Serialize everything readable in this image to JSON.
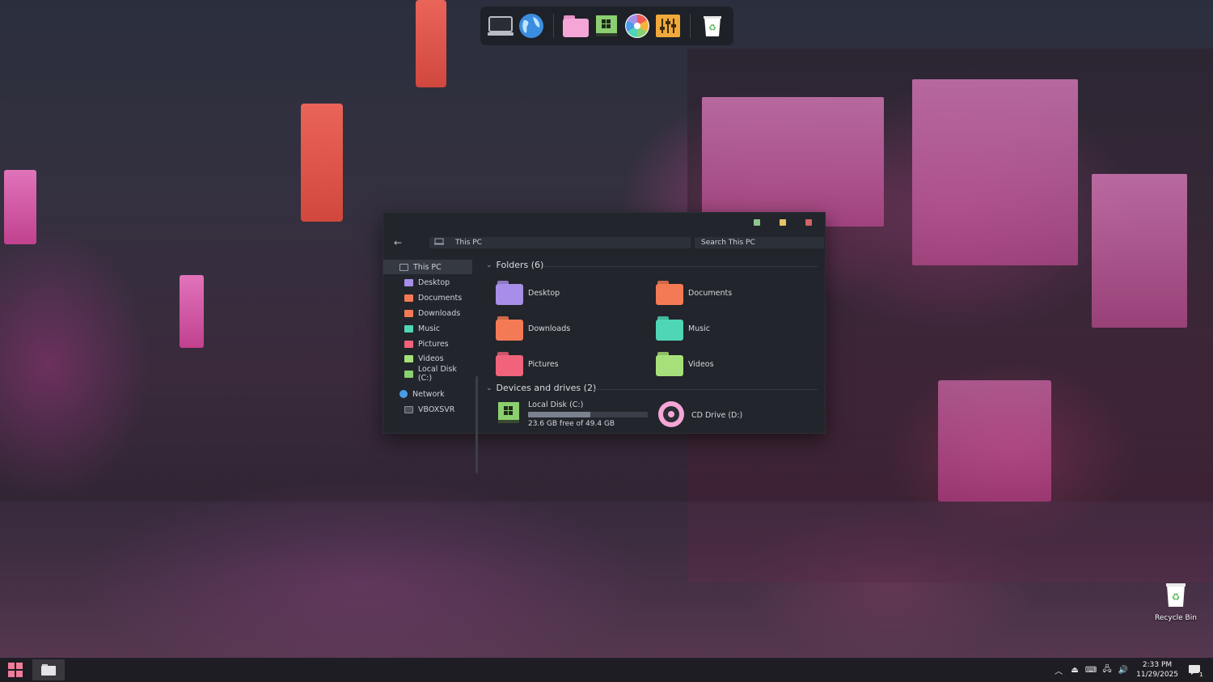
{
  "dock": {
    "items": [
      "this-pc-icon",
      "globe-icon",
      "folder-icon",
      "windows-icon",
      "color-wheel-icon",
      "mixer-icon",
      "recycle-bin-icon"
    ]
  },
  "explorer": {
    "address": "This PC",
    "search_placeholder": "Search This PC",
    "window_buttons": {
      "minimize": "#8fc58f",
      "maximize": "#e7c46a",
      "close": "#d36464"
    },
    "sidebar": {
      "items": [
        {
          "label": "This PC",
          "color": "#3e424c"
        },
        {
          "label": "Desktop",
          "color": "#a78ee8"
        },
        {
          "label": "Documents",
          "color": "#f47a56"
        },
        {
          "label": "Downloads",
          "color": "#f47a56"
        },
        {
          "label": "Music",
          "color": "#4fd6b6"
        },
        {
          "label": "Pictures",
          "color": "#f0637a"
        },
        {
          "label": "Videos",
          "color": "#a7e07a"
        },
        {
          "label": "Local Disk (C:)",
          "color": "#8bd070"
        },
        {
          "label": "Network",
          "color": "#4a9be8"
        },
        {
          "label": "VBOXSVR",
          "color": "#4a4e58"
        }
      ]
    },
    "folders_header": "Folders (6)",
    "folders": [
      {
        "label": "Desktop",
        "color": "#a78ee8"
      },
      {
        "label": "Documents",
        "color": "#f47a56"
      },
      {
        "label": "Downloads",
        "color": "#f47a56"
      },
      {
        "label": "Music",
        "color": "#4fd6b6"
      },
      {
        "label": "Pictures",
        "color": "#f0637a"
      },
      {
        "label": "Videos",
        "color": "#a7e07a"
      }
    ],
    "devices_header": "Devices and drives (2)",
    "drives": {
      "c": {
        "label": "Local Disk (C:)",
        "free_text": "23.6 GB free of 49.4 GB",
        "used_fraction": 0.52
      },
      "d": {
        "label": "CD Drive (D:)"
      }
    }
  },
  "desktop": {
    "recycle_bin_label": "Recycle Bin"
  },
  "taskbar": {
    "time": "2:33 PM",
    "date": "11/29/2025",
    "notification_count": "1"
  }
}
